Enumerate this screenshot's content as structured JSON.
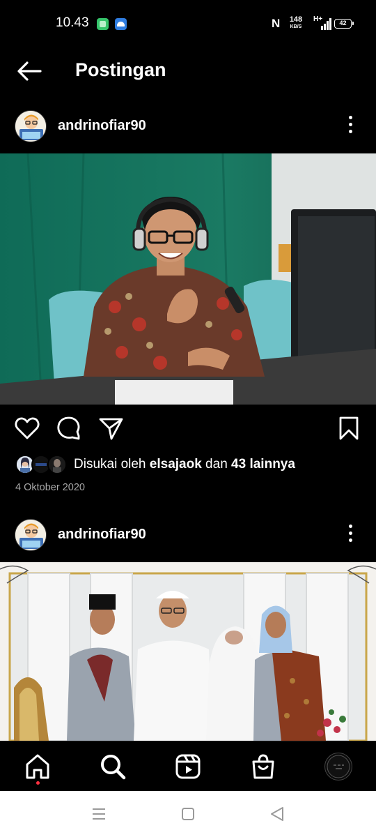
{
  "status_bar": {
    "time": "10.43",
    "net_speed_value": "148",
    "net_speed_unit": "KB/S",
    "network_type": "H+",
    "battery": "42"
  },
  "header": {
    "title": "Postingan"
  },
  "posts": [
    {
      "username": "andrinofiar90",
      "likes_prefix": "Disukai oleh ",
      "liked_by": "elsajaok",
      "likes_middle": " dan ",
      "likes_others": "43 lainnya",
      "date": "4 Oktober 2020"
    },
    {
      "username": "andrinofiar90"
    }
  ],
  "icons": {
    "back": "arrow-left-icon",
    "more": "more-vertical-icon",
    "like": "heart-icon",
    "comment": "comment-icon",
    "share": "paper-plane-icon",
    "save": "bookmark-icon",
    "home": "home-icon",
    "search": "search-icon",
    "reels": "reels-icon",
    "shop": "shopping-bag-icon",
    "profile": "profile-avatar",
    "sys_menu": "menu-icon",
    "sys_home": "square-icon",
    "sys_back": "triangle-back-icon"
  },
  "colors": {
    "background": "#000000",
    "text": "#ffffff",
    "secondary_text": "#a8a8a8",
    "notification_dot": "#ff3040",
    "system_nav_bg": "#ffffff"
  }
}
